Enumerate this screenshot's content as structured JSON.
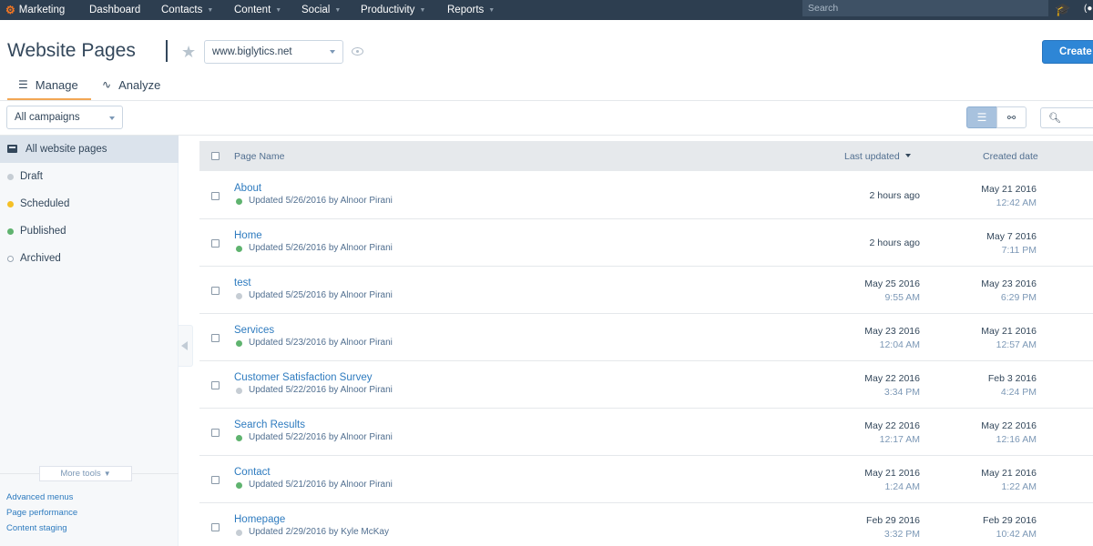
{
  "topnav": {
    "brand": "Marketing",
    "items": [
      {
        "label": "Dashboard",
        "has_caret": false
      },
      {
        "label": "Contacts",
        "has_caret": true
      },
      {
        "label": "Content",
        "has_caret": true
      },
      {
        "label": "Social",
        "has_caret": true
      },
      {
        "label": "Productivity",
        "has_caret": true
      },
      {
        "label": "Reports",
        "has_caret": true
      }
    ],
    "search_placeholder": "Search",
    "grad_icon": "graduation-cap-icon",
    "user_icon": "user-status-icon"
  },
  "header": {
    "title": "Website Pages",
    "domain": "www.biglytics.net",
    "create_label": "Create"
  },
  "tabs": [
    {
      "label": "Manage",
      "icon": "list-icon",
      "active": true
    },
    {
      "label": "Analyze",
      "icon": "pulse-icon",
      "active": false
    }
  ],
  "filters": {
    "campaign": "All campaigns"
  },
  "sidebar": {
    "items": [
      {
        "label": "All website pages",
        "active": true,
        "dot_color": null
      },
      {
        "label": "Draft",
        "active": false,
        "dot_color": "#c6cdd4"
      },
      {
        "label": "Scheduled",
        "active": false,
        "dot_color": "#f5c026"
      },
      {
        "label": "Published",
        "active": false,
        "dot_color": "#5fb36f"
      },
      {
        "label": "Archived",
        "active": false,
        "dot_color": "hollow"
      }
    ],
    "more_tools": "More tools",
    "links": [
      "Advanced menus",
      "Page performance",
      "Content staging"
    ]
  },
  "table": {
    "headers": {
      "name": "Page Name",
      "last_updated": "Last updated",
      "created": "Created date"
    },
    "rows": [
      {
        "name": "About",
        "status_color": "#5fb36f",
        "updated": "Updated 5/26/2016 by Alnoor Pirani",
        "last_updated": "2 hours ago",
        "last_updated_time": "",
        "created": "May 21 2016",
        "created_time": "12:42 AM"
      },
      {
        "name": "Home",
        "status_color": "#5fb36f",
        "updated": "Updated 5/26/2016 by Alnoor Pirani",
        "last_updated": "2 hours ago",
        "last_updated_time": "",
        "created": "May 7 2016",
        "created_time": "7:11 PM"
      },
      {
        "name": "test",
        "status_color": "#c6cdd4",
        "updated": "Updated 5/25/2016 by Alnoor Pirani",
        "last_updated": "May 25 2016",
        "last_updated_time": "9:55 AM",
        "created": "May 23 2016",
        "created_time": "6:29 PM"
      },
      {
        "name": "Services",
        "status_color": "#5fb36f",
        "updated": "Updated 5/23/2016 by Alnoor Pirani",
        "last_updated": "May 23 2016",
        "last_updated_time": "12:04 AM",
        "created": "May 21 2016",
        "created_time": "12:57 AM"
      },
      {
        "name": "Customer Satisfaction Survey",
        "status_color": "#c6cdd4",
        "updated": "Updated 5/22/2016 by Alnoor Pirani",
        "last_updated": "May 22 2016",
        "last_updated_time": "3:34 PM",
        "created": "Feb 3 2016",
        "created_time": "4:24 PM"
      },
      {
        "name": "Search Results",
        "status_color": "#5fb36f",
        "updated": "Updated 5/22/2016 by Alnoor Pirani",
        "last_updated": "May 22 2016",
        "last_updated_time": "12:17 AM",
        "created": "May 22 2016",
        "created_time": "12:16 AM"
      },
      {
        "name": "Contact",
        "status_color": "#5fb36f",
        "updated": "Updated 5/21/2016 by Alnoor Pirani",
        "last_updated": "May 21 2016",
        "last_updated_time": "1:24 AM",
        "created": "May 21 2016",
        "created_time": "1:22 AM"
      },
      {
        "name": "Homepage",
        "status_color": "#c6cdd4",
        "updated": "Updated 2/29/2016 by Kyle McKay",
        "last_updated": "Feb 29 2016",
        "last_updated_time": "3:32 PM",
        "created": "Feb 29 2016",
        "created_time": "10:42 AM"
      }
    ]
  },
  "colors": {
    "nav_bg": "#2d3e50",
    "brand_orange": "#f57722",
    "accent_blue": "#2e86d6",
    "link_blue": "#2e7bbf",
    "published_green": "#5fb36f",
    "draft_gray": "#c6cdd4",
    "scheduled_yellow": "#f5c026"
  }
}
